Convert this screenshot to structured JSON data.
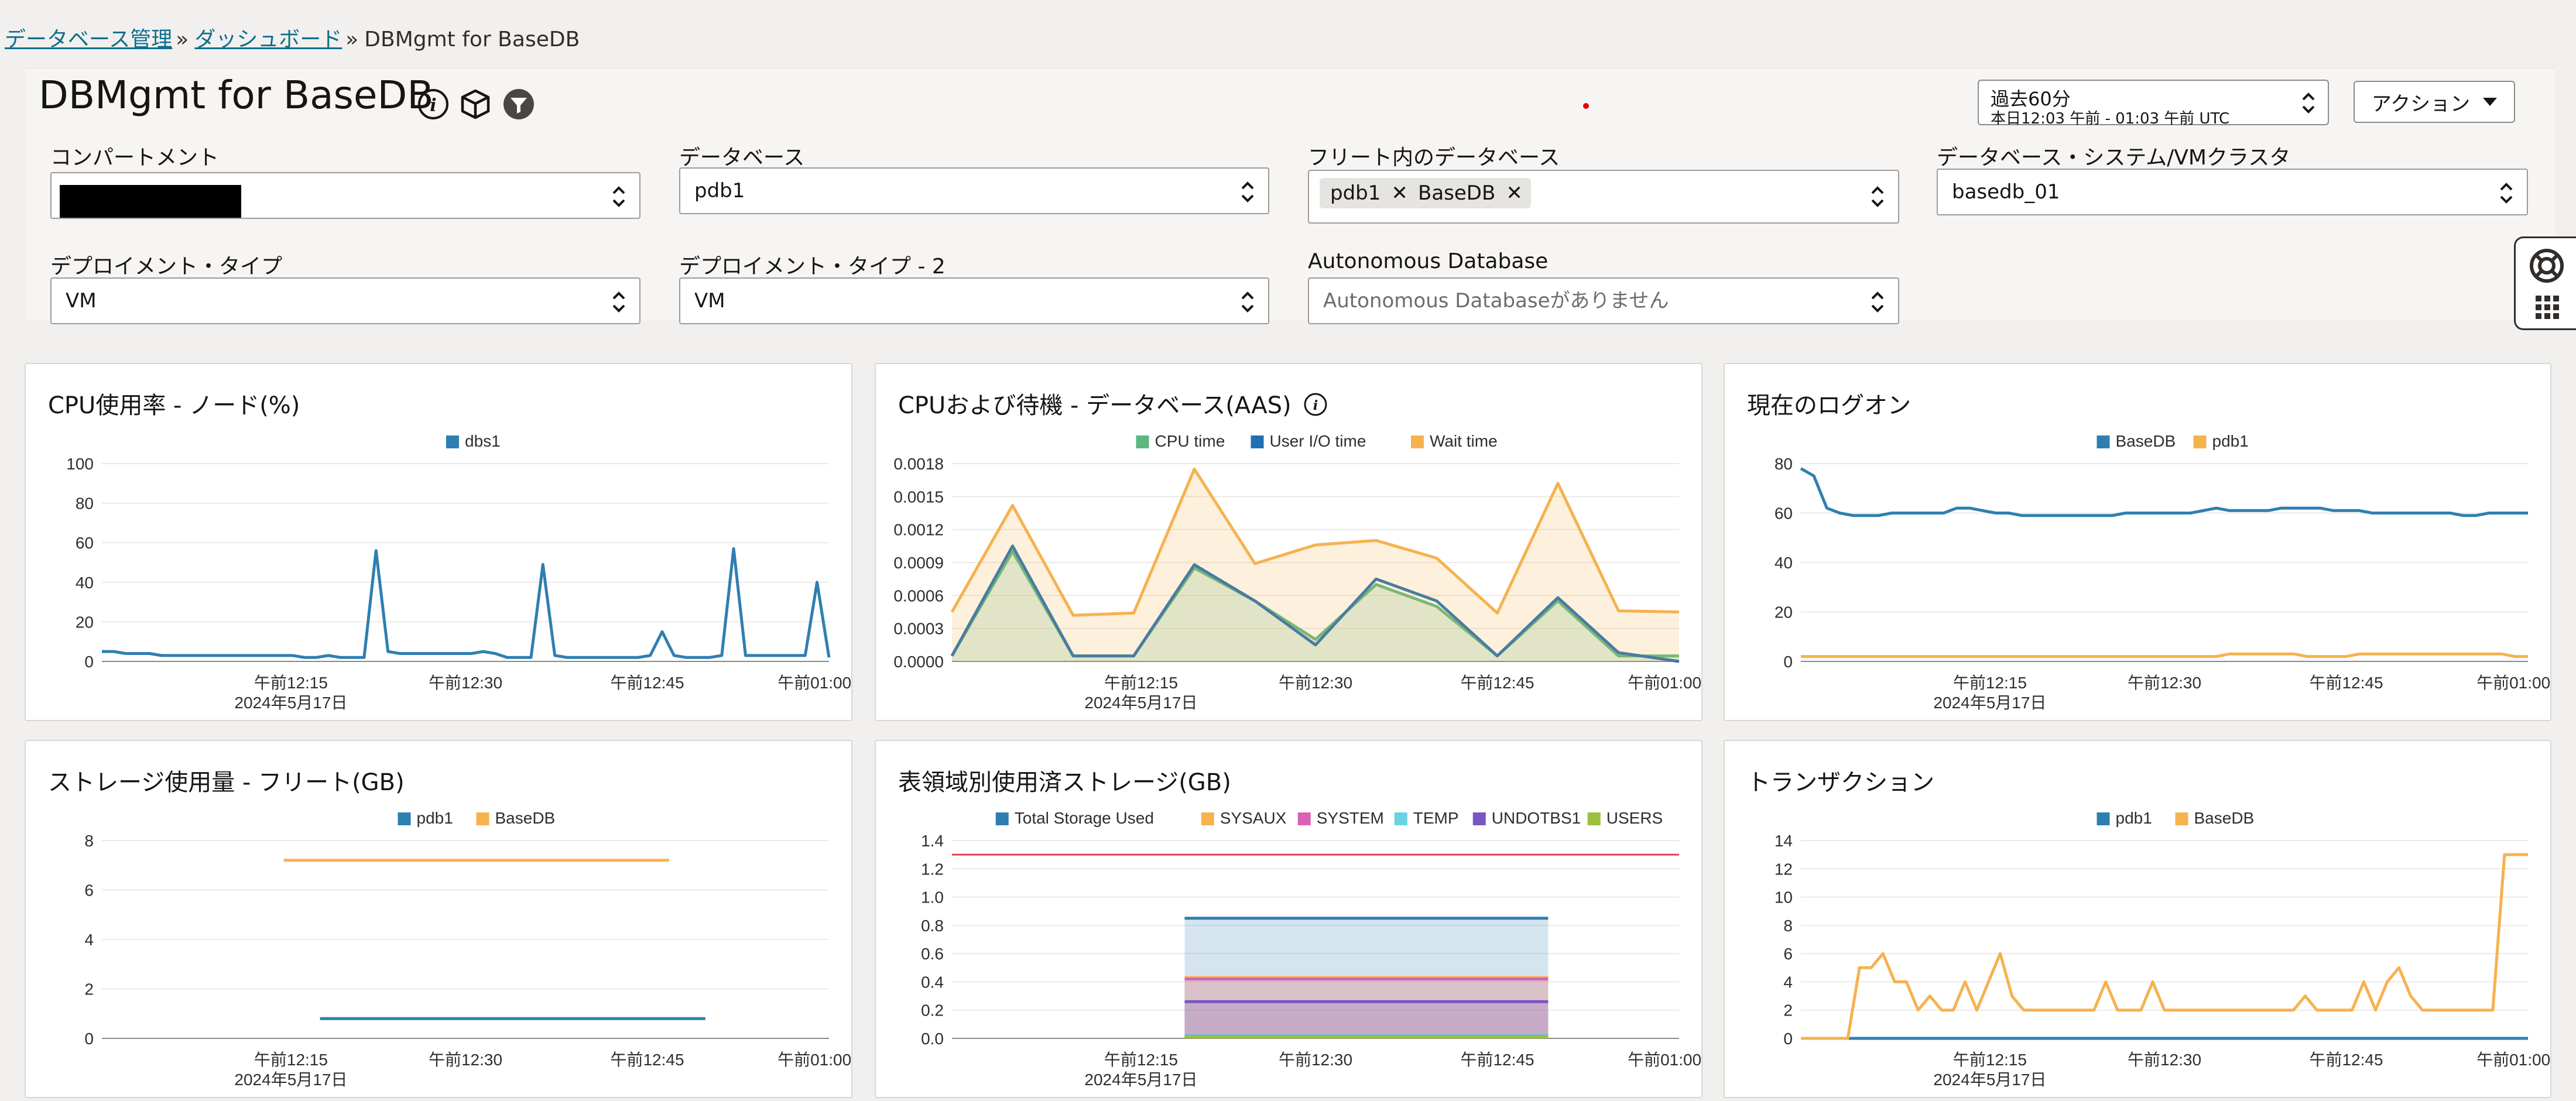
{
  "breadcrumb": {
    "items": [
      "データベース管理",
      "ダッシュボード",
      "DBMgmt for BaseDB"
    ],
    "separator": "»"
  },
  "page": {
    "title": "DBMgmt for BaseDB"
  },
  "icons": {
    "info": "info-icon",
    "cube": "cube-icon",
    "filter": "filter-icon",
    "help": "lifebuoy-icon",
    "apps": "grid-icon"
  },
  "time_range": {
    "label": "過去60分",
    "detail": "本日12:03 午前 - 01:03 午前 UTC"
  },
  "actions": {
    "label": "アクション"
  },
  "filters": {
    "compartment": {
      "label": "コンパートメント",
      "value": ""
    },
    "database": {
      "label": "データベース",
      "value": "pdb1"
    },
    "fleet": {
      "label": "フリート内のデータベース",
      "chips": [
        "pdb1",
        "BaseDB"
      ]
    },
    "db_system": {
      "label": "データベース・システム/VMクラスタ",
      "value": "basedb_01"
    },
    "deploy_type": {
      "label": "デプロイメント・タイプ",
      "value": "VM"
    },
    "deploy_type2": {
      "label": "デプロイメント・タイプ - 2",
      "value": "VM"
    },
    "autonomous": {
      "label": "Autonomous Database",
      "placeholder": "Autonomous Databaseがありません"
    }
  },
  "colors": {
    "blue": "#2e7fb1",
    "orange": "#f6b24f",
    "green": "#5cb87e",
    "pink": "#d961b6",
    "cyan": "#6ad3e3",
    "purple": "#7a55c4",
    "olive": "#9cbf3c",
    "red": "#e04050",
    "accent_link": "#0f6e8c"
  },
  "chart_data": [
    {
      "id": "cpu_node",
      "type": "line",
      "title": "CPU使用率 - ノード(%)",
      "legend": "top",
      "grid": true,
      "ylim": [
        0,
        100
      ],
      "yticks": [
        0,
        20,
        40,
        60,
        80,
        100
      ],
      "xticks": [
        "午前12:15",
        "午前12:30",
        "午前12:45",
        "午前01:00"
      ],
      "xdate": "2024年5月17日",
      "series": [
        {
          "name": "dbs1",
          "color": "#2e7fb1",
          "area": false,
          "values": [
            5,
            5,
            4,
            4,
            4,
            3,
            3,
            3,
            3,
            3,
            3,
            3,
            3,
            3,
            3,
            3,
            3,
            2,
            2,
            3,
            2,
            2,
            2,
            56,
            5,
            4,
            4,
            4,
            4,
            4,
            4,
            4,
            5,
            4,
            2,
            2,
            2,
            49,
            3,
            2,
            2,
            2,
            2,
            2,
            2,
            2,
            3,
            15,
            3,
            2,
            2,
            2,
            3,
            57,
            3,
            3,
            3,
            3,
            3,
            3,
            40,
            2
          ]
        }
      ]
    },
    {
      "id": "cpu_wait",
      "type": "area",
      "title": "CPUおよび待機 - データベース(AAS)",
      "legend": "top",
      "grid": true,
      "ylim": [
        0,
        0.0018
      ],
      "yticks": [
        0,
        0.0003,
        0.0006,
        0.0009,
        0.0012,
        0.0015,
        0.0018
      ],
      "ydecimals": 4,
      "xticks": [
        "午前12:15",
        "午前12:30",
        "午前12:45",
        "午前01:00"
      ],
      "xdate": "2024年5月17日",
      "series": [
        {
          "name": "CPU time",
          "color": "#5cb87e",
          "area": true,
          "values": [
            5e-05,
            0.001,
            5e-05,
            5e-05,
            0.00085,
            0.00055,
            0.0002,
            0.0007,
            0.0005,
            5e-05,
            0.00055,
            5e-05,
            5e-05
          ]
        },
        {
          "name": "User I/O time",
          "color": "#1f6fb4",
          "area": false,
          "values": [
            5e-05,
            0.00105,
            5e-05,
            5e-05,
            0.00088,
            0.00055,
            0.00015,
            0.00075,
            0.00055,
            5e-05,
            0.00058,
            8e-05,
            0.0
          ]
        },
        {
          "name": "Wait time",
          "color": "#f6b24f",
          "area": true,
          "values": [
            0.00045,
            0.00142,
            0.00042,
            0.00044,
            0.00175,
            0.00089,
            0.00106,
            0.0011,
            0.00094,
            0.00044,
            0.00162,
            0.00046,
            0.00045
          ]
        }
      ]
    },
    {
      "id": "logons",
      "type": "line",
      "title": "現在のログオン",
      "legend": "top",
      "grid": true,
      "ylim": [
        0,
        80
      ],
      "yticks": [
        0,
        20,
        40,
        60,
        80
      ],
      "xticks": [
        "午前12:15",
        "午前12:30",
        "午前12:45",
        "午前01:00"
      ],
      "xdate": "2024年5月17日",
      "series": [
        {
          "name": "BaseDB",
          "color": "#2e7fb1",
          "area": false,
          "values": [
            78,
            75,
            62,
            60,
            59,
            59,
            59,
            60,
            60,
            60,
            60,
            60,
            62,
            62,
            61,
            60,
            60,
            59,
            59,
            59,
            59,
            59,
            59,
            59,
            59,
            60,
            60,
            60,
            60,
            60,
            60,
            61,
            62,
            61,
            61,
            61,
            61,
            62,
            62,
            62,
            62,
            61,
            61,
            61,
            60,
            60,
            60,
            60,
            60,
            60,
            60,
            59,
            59,
            60,
            60,
            60,
            60
          ]
        },
        {
          "name": "pdb1",
          "color": "#f6b24f",
          "area": false,
          "values": [
            2,
            2,
            2,
            2,
            2,
            2,
            2,
            2,
            2,
            2,
            2,
            2,
            2,
            2,
            2,
            2,
            2,
            2,
            2,
            2,
            2,
            2,
            2,
            2,
            2,
            2,
            2,
            2,
            2,
            2,
            2,
            2,
            2,
            3,
            3,
            3,
            3,
            3,
            3,
            2,
            2,
            2,
            2,
            3,
            3,
            3,
            3,
            3,
            3,
            3,
            3,
            3,
            3,
            3,
            3,
            2,
            2
          ]
        }
      ]
    },
    {
      "id": "storage_fleet",
      "type": "line",
      "title": "ストレージ使用量 - フリート(GB)",
      "legend": "top",
      "grid": true,
      "ylim": [
        0,
        8
      ],
      "yticks": [
        0,
        2,
        4,
        6,
        8
      ],
      "xticks": [
        "午前12:15",
        "午前12:30",
        "午前12:45",
        "午前01:00"
      ],
      "xdate": "2024年5月17日",
      "series": [
        {
          "name": "pdb1",
          "color": "#2e7fb1",
          "area": false,
          "x": [
            0.3,
            0.83
          ],
          "values": [
            0.8,
            0.8
          ]
        },
        {
          "name": "BaseDB",
          "color": "#f6b24f",
          "area": false,
          "x": [
            0.25,
            0.78
          ],
          "values": [
            7.2,
            7.2
          ]
        }
      ]
    },
    {
      "id": "tablespace",
      "type": "area",
      "title": "表領域別使用済ストレージ(GB)",
      "legend": "top",
      "grid": true,
      "ylim": [
        0,
        1.4
      ],
      "yticks": [
        0,
        0.2,
        0.4,
        0.6,
        0.8,
        1.0,
        1.2,
        1.4
      ],
      "ydecimals": 1,
      "threshold": 1.3,
      "xticks": [
        "午前12:15",
        "午前12:30",
        "午前12:45",
        "午前01:00"
      ],
      "xdate": "2024年5月17日",
      "series": [
        {
          "name": "Total Storage Used",
          "color": "#2e7fb1",
          "area": true,
          "x": [
            0.32,
            0.82
          ],
          "values": [
            0.85,
            0.85
          ]
        },
        {
          "name": "SYSAUX",
          "color": "#f6b24f",
          "area": true,
          "x": [
            0.32,
            0.82
          ],
          "values": [
            0.43,
            0.43
          ]
        },
        {
          "name": "SYSTEM",
          "color": "#d961b6",
          "area": true,
          "x": [
            0.32,
            0.82
          ],
          "values": [
            0.42,
            0.42
          ]
        },
        {
          "name": "TEMP",
          "color": "#6ad3e3",
          "area": true,
          "x": [
            0.32,
            0.82
          ],
          "values": [
            0.02,
            0.02
          ]
        },
        {
          "name": "UNDOTBS1",
          "color": "#7a55c4",
          "area": true,
          "x": [
            0.32,
            0.82
          ],
          "values": [
            0.26,
            0.26
          ]
        },
        {
          "name": "USERS",
          "color": "#9cbf3c",
          "area": true,
          "x": [
            0.32,
            0.82
          ],
          "values": [
            0.01,
            0.01
          ]
        }
      ]
    },
    {
      "id": "transactions",
      "type": "line",
      "title": "トランザクション",
      "legend": "top",
      "grid": true,
      "ylim": [
        0,
        14
      ],
      "yticks": [
        0,
        2,
        4,
        6,
        8,
        10,
        12,
        14
      ],
      "xticks": [
        "午前12:15",
        "午前12:30",
        "午前12:45",
        "午前01:00"
      ],
      "xdate": "2024年5月17日",
      "series": [
        {
          "name": "pdb1",
          "color": "#2e7fb1",
          "area": false,
          "values": [
            0,
            0,
            0,
            0,
            0,
            0,
            0,
            0,
            0,
            0,
            0,
            0,
            0,
            0,
            0,
            0,
            0,
            0,
            0,
            0,
            0,
            0,
            0,
            0,
            0,
            0,
            0,
            0,
            0,
            0,
            0,
            0,
            0,
            0,
            0,
            0,
            0,
            0,
            0,
            0,
            0,
            0,
            0,
            0,
            0,
            0,
            0,
            0,
            0,
            0,
            0,
            0,
            0,
            0,
            0,
            0,
            0,
            0,
            0,
            0,
            0,
            0,
            0
          ]
        },
        {
          "name": "BaseDB",
          "color": "#f6b24f",
          "area": false,
          "values": [
            0,
            0,
            0,
            0,
            0,
            5,
            5,
            6,
            4,
            4,
            2,
            3,
            2,
            2,
            4,
            2,
            4,
            6,
            3,
            2,
            2,
            2,
            2,
            2,
            2,
            2,
            4,
            2,
            2,
            2,
            4,
            2,
            2,
            2,
            2,
            2,
            2,
            2,
            2,
            2,
            2,
            2,
            2,
            3,
            2,
            2,
            2,
            2,
            4,
            2,
            4,
            5,
            3,
            2,
            2,
            2,
            2,
            2,
            2,
            2,
            13,
            13,
            13
          ]
        }
      ]
    }
  ]
}
